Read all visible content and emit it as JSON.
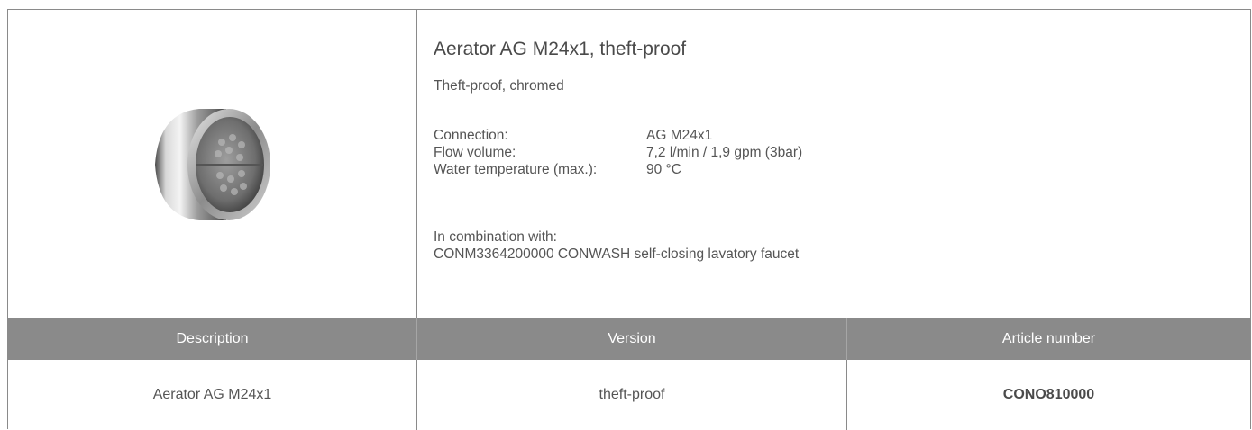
{
  "product": {
    "title": "Aerator AG M24x1, theft-proof",
    "subtitle": "Theft-proof, chromed",
    "specs": [
      {
        "label": "Connection:",
        "value": "AG M24x1"
      },
      {
        "label": "Flow volume:",
        "value": "7,2 l/min / 1,9 gpm (3bar)"
      },
      {
        "label": "Water temperature (max.):",
        "value": "90 °C"
      }
    ],
    "combination_label": "In combination with:",
    "combination_item": "CONM3364200000 CONWASH self-closing lavatory faucet",
    "image_icon": "aerator-product-photo"
  },
  "table": {
    "headers": [
      "Description",
      "Version",
      "Article number"
    ],
    "rows": [
      [
        "Aerator AG M24x1",
        "theft-proof",
        "CONO810000"
      ]
    ]
  },
  "colors": {
    "header_bg": "#8a8a8a",
    "border": "#8a8a8a",
    "text": "#555555"
  }
}
